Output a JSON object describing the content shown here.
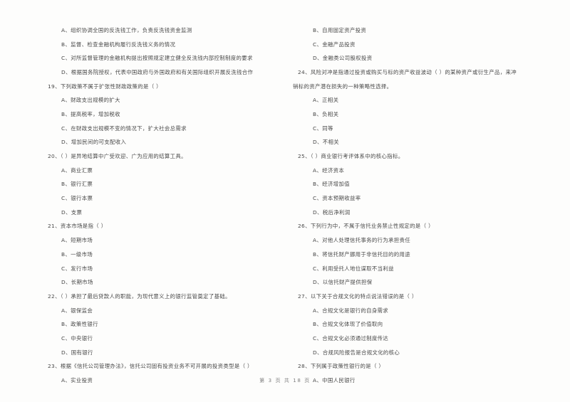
{
  "document": {
    "type": "scanned-exam-paper",
    "footer": "第 3 页 共 18 页",
    "page_number": "3",
    "total_pages": "18"
  },
  "left_column": {
    "lines": [
      {
        "kind": "option",
        "text": "A、组织协调全国的反洗钱工作，负责反洗钱资金监测"
      },
      {
        "kind": "option",
        "text": "B、监督、检查金融机构履行反洗钱义务的情况"
      },
      {
        "kind": "option",
        "text": "C、对所监督管理的金融机构提出按照规定建立健全反洗钱内部控制制度的要求"
      },
      {
        "kind": "option",
        "text": "D、根据国务院授权，代表中国政府与外国政府和有关国际组织开展反洗钱合作"
      },
      {
        "kind": "stem",
        "text": "19、下列政策不属于扩张性财政政策的是（        ）"
      },
      {
        "kind": "option",
        "text": "A、财政支出规模的扩大"
      },
      {
        "kind": "option",
        "text": "B、提高税率，增加税收"
      },
      {
        "kind": "option",
        "text": "C、在财政支出规模不变的情况下，扩大社会总需求"
      },
      {
        "kind": "option",
        "text": "D、增加民间的可支配收入"
      },
      {
        "kind": "stem",
        "text": "20、（       ）是异地结算中广受欢迎、广为应用的结算工具。"
      },
      {
        "kind": "option",
        "text": "A、商业汇票"
      },
      {
        "kind": "option",
        "text": "B、银行汇票"
      },
      {
        "kind": "option",
        "text": "C、银行本票"
      },
      {
        "kind": "option",
        "text": "D、支票"
      },
      {
        "kind": "stem",
        "text": "21、资本市场是指（        ）"
      },
      {
        "kind": "option",
        "text": "A、短期市场"
      },
      {
        "kind": "option",
        "text": "B、一级市场"
      },
      {
        "kind": "option",
        "text": "C、发行市场"
      },
      {
        "kind": "option",
        "text": "D、长期市场"
      },
      {
        "kind": "stem",
        "text": "22、（       ）承担了最后贷款人的职能，为现代意义上的银行监管奠定了基础。"
      },
      {
        "kind": "option",
        "text": "A、银保监会"
      },
      {
        "kind": "option",
        "text": "B、政策性银行"
      },
      {
        "kind": "option",
        "text": "C、中央银行"
      },
      {
        "kind": "option",
        "text": "D、国有银行"
      },
      {
        "kind": "stem",
        "text": "23、根据《信托公司管理办法》，信托公司固有投资业务不可开展的投资类型是（        ）"
      },
      {
        "kind": "option",
        "text": "A、实业投资"
      }
    ]
  },
  "right_column": {
    "lines": [
      {
        "kind": "option",
        "text": "B、自用固定资产投资"
      },
      {
        "kind": "option",
        "text": "C、金融产品投资"
      },
      {
        "kind": "option",
        "text": "D、金融类公司股权投资"
      },
      {
        "kind": "stem",
        "text": "24、风险对冲是指通过投资或购买与标的资产收益波动（        ）的某种资产或衍生产品，来冲"
      },
      {
        "kind": "cont",
        "text": "销标的资产潜在损失的一种策略性选择。"
      },
      {
        "kind": "option",
        "text": "A、正相关"
      },
      {
        "kind": "option",
        "text": "B、负相关"
      },
      {
        "kind": "option",
        "text": "C、同等"
      },
      {
        "kind": "option",
        "text": "D、不相关"
      },
      {
        "kind": "stem",
        "text": "25、（       ）商业银行考评体系中的核心指标。"
      },
      {
        "kind": "option",
        "text": "A、经济资本"
      },
      {
        "kind": "option",
        "text": "B、经济增加值"
      },
      {
        "kind": "option",
        "text": "C、资本预期收益率"
      },
      {
        "kind": "option",
        "text": "D、税后净利润"
      },
      {
        "kind": "stem",
        "text": "26、下列行为中，不属于信托业务禁止性规定的是（        ）"
      },
      {
        "kind": "option",
        "text": "A、对他人处理信托事务的行为承担责任"
      },
      {
        "kind": "option",
        "text": "B、将信托财产挪用于非信托目的的用途"
      },
      {
        "kind": "option",
        "text": "C、利用受托人地位谋取不当利益"
      },
      {
        "kind": "option",
        "text": "D、以信托财产提供担保"
      },
      {
        "kind": "stem",
        "text": "27、以下关于合规文化的特点说法错误的是（        ）"
      },
      {
        "kind": "option",
        "text": "A、合规文化是银行的自身需求"
      },
      {
        "kind": "option",
        "text": "B、合规文化体现了价值取向"
      },
      {
        "kind": "option",
        "text": "C、合规文化必须通过制度传达"
      },
      {
        "kind": "option",
        "text": "D、合规风险报告是合规文化的核心"
      },
      {
        "kind": "stem",
        "text": "28、下列属于政策性银行的是（        ）"
      },
      {
        "kind": "option",
        "text": "A、中国人民银行"
      }
    ]
  }
}
